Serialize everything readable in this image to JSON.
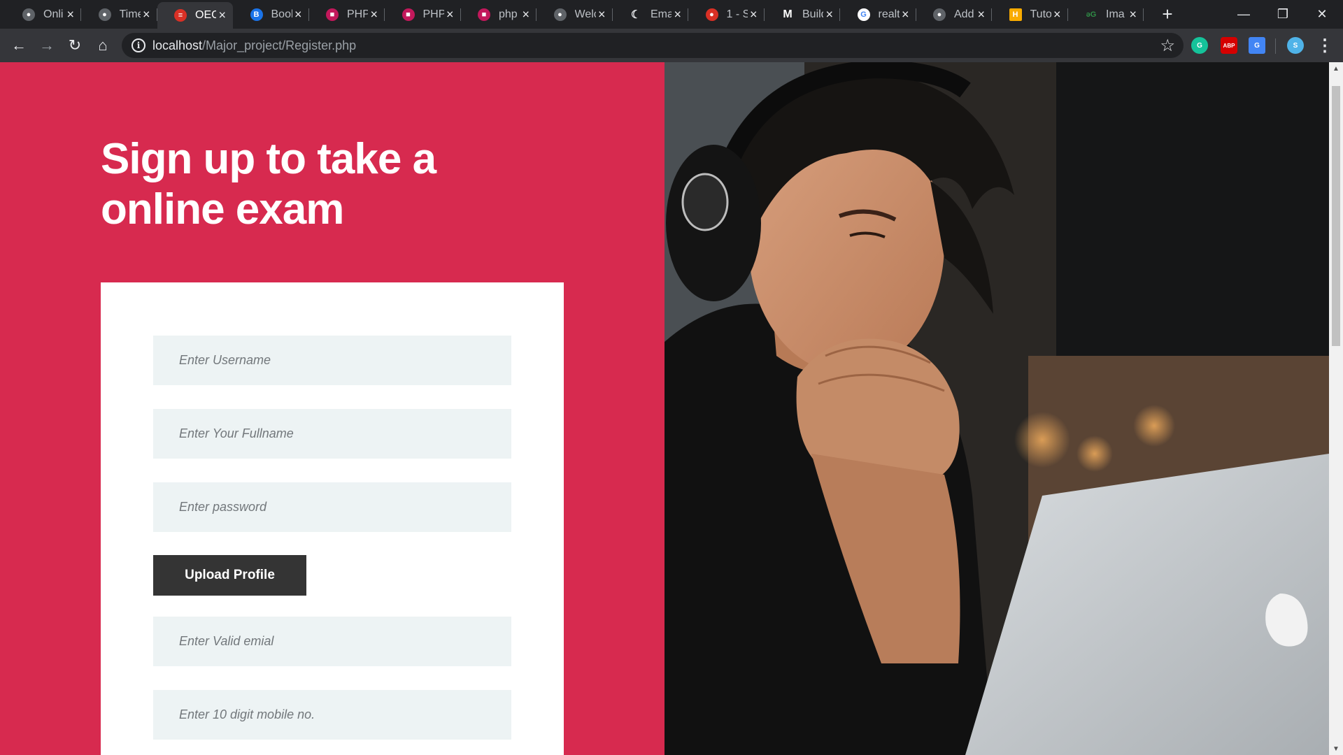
{
  "browser": {
    "tabs": [
      {
        "title": "Onli",
        "favicon": "globe-icon",
        "color": "#5f6368"
      },
      {
        "title": "Time",
        "favicon": "globe-icon",
        "color": "#5f6368"
      },
      {
        "title": "OEC",
        "favicon": "site-logo-icon",
        "color": "#d93025",
        "active": true
      },
      {
        "title": "Book",
        "favicon": "bootstrap-icon",
        "color": "#1a73e8"
      },
      {
        "title": "PHP",
        "favicon": "php-book-icon",
        "color": "#c2185b"
      },
      {
        "title": "PHP",
        "favicon": "php-book-icon",
        "color": "#c2185b"
      },
      {
        "title": "php",
        "favicon": "php-book-icon",
        "color": "#c2185b"
      },
      {
        "title": "Welc",
        "favicon": "globe-icon",
        "color": "#5f6368"
      },
      {
        "title": "Ema",
        "favicon": "moon-icon",
        "color": "#e8eaed"
      },
      {
        "title": "1 - S",
        "favicon": "recording-icon",
        "color": "#d93025"
      },
      {
        "title": "Build",
        "favicon": "medium-icon",
        "color": "#ffffff"
      },
      {
        "title": "realt",
        "favicon": "google-icon",
        "color": "#4285f4"
      },
      {
        "title": "Add",
        "favicon": "globe-icon",
        "color": "#5f6368"
      },
      {
        "title": "Tuto",
        "favicon": "h-icon",
        "color": "#f9ab00"
      },
      {
        "title": "Ima",
        "favicon": "geeksforgeeks-icon",
        "color": "#2f8d46"
      }
    ],
    "address": {
      "host": "localhost",
      "path": "/Major_project/Register.php"
    },
    "extensions": [
      {
        "name": "grammarly-icon",
        "color": "#15c39a",
        "glyph": "G"
      },
      {
        "name": "adblock-icon",
        "color": "#d50000",
        "glyph": "ABP"
      },
      {
        "name": "google-translate-icon",
        "color": "#4285f4",
        "glyph": "G"
      },
      {
        "name": "profile-avatar-icon",
        "color": "#4fb3e8",
        "glyph": "S"
      }
    ]
  },
  "page": {
    "headline": "Sign up to take a online exam",
    "form": {
      "username_placeholder": "Enter Username",
      "fullname_placeholder": "Enter Your Fullname",
      "password_placeholder": "Enter password",
      "upload_label": "Upload Profile",
      "email_placeholder": "Enter Valid emial",
      "mobile_placeholder": "Enter 10 digit mobile no."
    },
    "colors": {
      "accent": "#d72a4f",
      "field_bg": "#edf3f4",
      "button_bg": "#343434"
    }
  }
}
